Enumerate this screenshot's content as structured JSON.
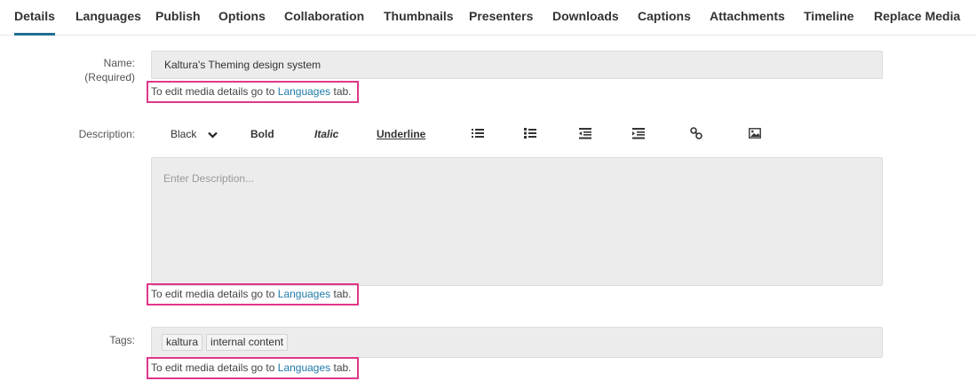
{
  "tabs": [
    {
      "label": "Details",
      "active": true
    },
    {
      "label": "Languages"
    },
    {
      "label": "Publish"
    },
    {
      "label": "Options"
    },
    {
      "label": "Collaboration"
    },
    {
      "label": "Thumbnails"
    },
    {
      "label": "Presenters"
    },
    {
      "label": "Downloads"
    },
    {
      "label": "Captions"
    },
    {
      "label": "Attachments"
    },
    {
      "label": "Timeline"
    },
    {
      "label": "Replace Media"
    }
  ],
  "name": {
    "label": "Name:",
    "required": "(Required)",
    "value": "Kaltura's Theming design system"
  },
  "hint": {
    "prefix": "To edit media details go to ",
    "link": "Languages",
    "suffix": " tab."
  },
  "description": {
    "label": "Description:",
    "placeholder": "Enter Description..."
  },
  "toolbar": {
    "color": "Black",
    "bold": "Bold",
    "italic": "Italic",
    "underline": "Underline",
    "icons": [
      "unordered-list-icon",
      "ordered-list-icon",
      "outdent-icon",
      "indent-icon",
      "link-icon",
      "image-icon"
    ]
  },
  "tags": {
    "label": "Tags:",
    "items": [
      "kaltura",
      "internal content"
    ]
  },
  "colors": {
    "accent": "#1f6e91",
    "link": "#1f7aa8",
    "highlight_box": "#e0378a",
    "field_bg": "#ececec"
  }
}
